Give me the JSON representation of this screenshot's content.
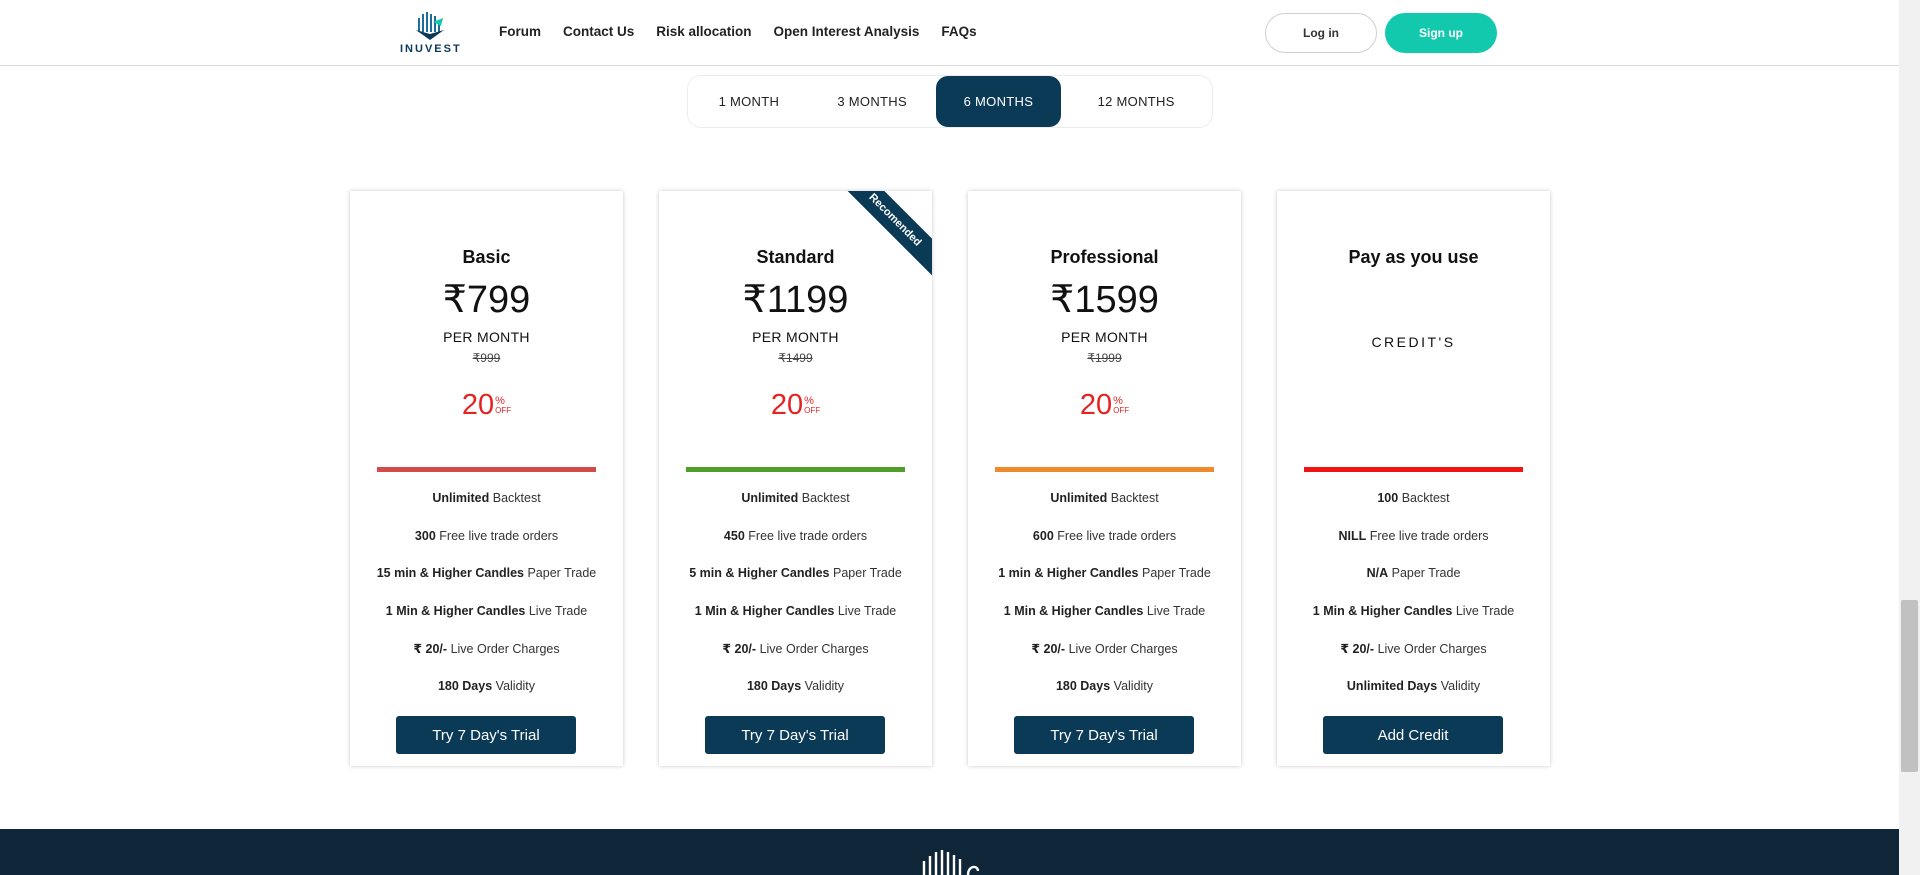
{
  "header": {
    "logo_text": "INUVEST",
    "nav": [
      "Forum",
      "Contact Us",
      "Risk allocation",
      "Open Interest Analysis",
      "FAQs"
    ],
    "login_label": "Log in",
    "signup_label": "Sign up"
  },
  "tabs": [
    "1 MONTH",
    "3 MONTHS",
    "6 MONTHS",
    "12 MONTHS"
  ],
  "selected_tab": "6 MONTHS",
  "plans": [
    {
      "title": "Basic",
      "price": "₹799",
      "per": "PER MONTH",
      "old_price": "₹999",
      "off_value": "20",
      "off_pct": "%",
      "off_text": "OFF",
      "bar_color": "#d24a4a",
      "features": [
        {
          "bold": "Unlimited",
          "text": "Backtest"
        },
        {
          "bold": "300",
          "text": "Free live trade orders"
        },
        {
          "bold": "15 min & Higher Candles",
          "text": "Paper Trade"
        },
        {
          "bold": "1 Min & Higher Candles",
          "text": "Live Trade"
        },
        {
          "bold": "₹ 20/-",
          "text": "Live Order Charges"
        },
        {
          "bold": "180 Days",
          "text": "Validity"
        }
      ],
      "button": "Try 7 Day's Trial"
    },
    {
      "title": "Standard",
      "price": "₹1199",
      "per": "PER MONTH",
      "old_price": "₹1499",
      "off_value": "20",
      "off_pct": "%",
      "off_text": "OFF",
      "bar_color": "#4f9d2b",
      "ribbon": "Recomended",
      "features": [
        {
          "bold": "Unlimited",
          "text": "Backtest"
        },
        {
          "bold": "450",
          "text": "Free live trade orders"
        },
        {
          "bold": "5 min & Higher Candles",
          "text": "Paper Trade"
        },
        {
          "bold": "1 Min & Higher Candles",
          "text": "Live Trade"
        },
        {
          "bold": "₹ 20/-",
          "text": "Live Order Charges"
        },
        {
          "bold": "180 Days",
          "text": "Validity"
        }
      ],
      "button": "Try 7 Day's Trial"
    },
    {
      "title": "Professional",
      "price": "₹1599",
      "per": "PER MONTH",
      "old_price": "₹1999",
      "off_value": "20",
      "off_pct": "%",
      "off_text": "OFF",
      "bar_color": "#ef8a2c",
      "features": [
        {
          "bold": "Unlimited",
          "text": "Backtest"
        },
        {
          "bold": "600",
          "text": "Free live trade orders"
        },
        {
          "bold": "1 min & Higher Candles",
          "text": "Paper Trade"
        },
        {
          "bold": "1 Min & Higher Candles",
          "text": "Live Trade"
        },
        {
          "bold": "₹ 20/-",
          "text": "Live Order Charges"
        },
        {
          "bold": "180 Days",
          "text": "Validity"
        }
      ],
      "button": "Try 7 Day's Trial"
    },
    {
      "title": "Pay as you use",
      "credits": "CREDIT'S",
      "bar_color": "#f01414",
      "features": [
        {
          "bold": "100",
          "text": "Backtest"
        },
        {
          "bold": "NILL",
          "text": "Free live trade orders"
        },
        {
          "bold": "N/A",
          "text": "Paper Trade"
        },
        {
          "bold": "1 Min & Higher Candles",
          "text": "Live Trade"
        },
        {
          "bold": "₹ 20/-",
          "text": "Live Order Charges"
        },
        {
          "bold": "Unlimited Days",
          "text": "Validity"
        }
      ],
      "button": "Add Credit"
    }
  ],
  "colors": {
    "primary": "#0b3a57",
    "accent": "#13c9ad",
    "discount": "#e42424",
    "footer": "#0f2538"
  }
}
